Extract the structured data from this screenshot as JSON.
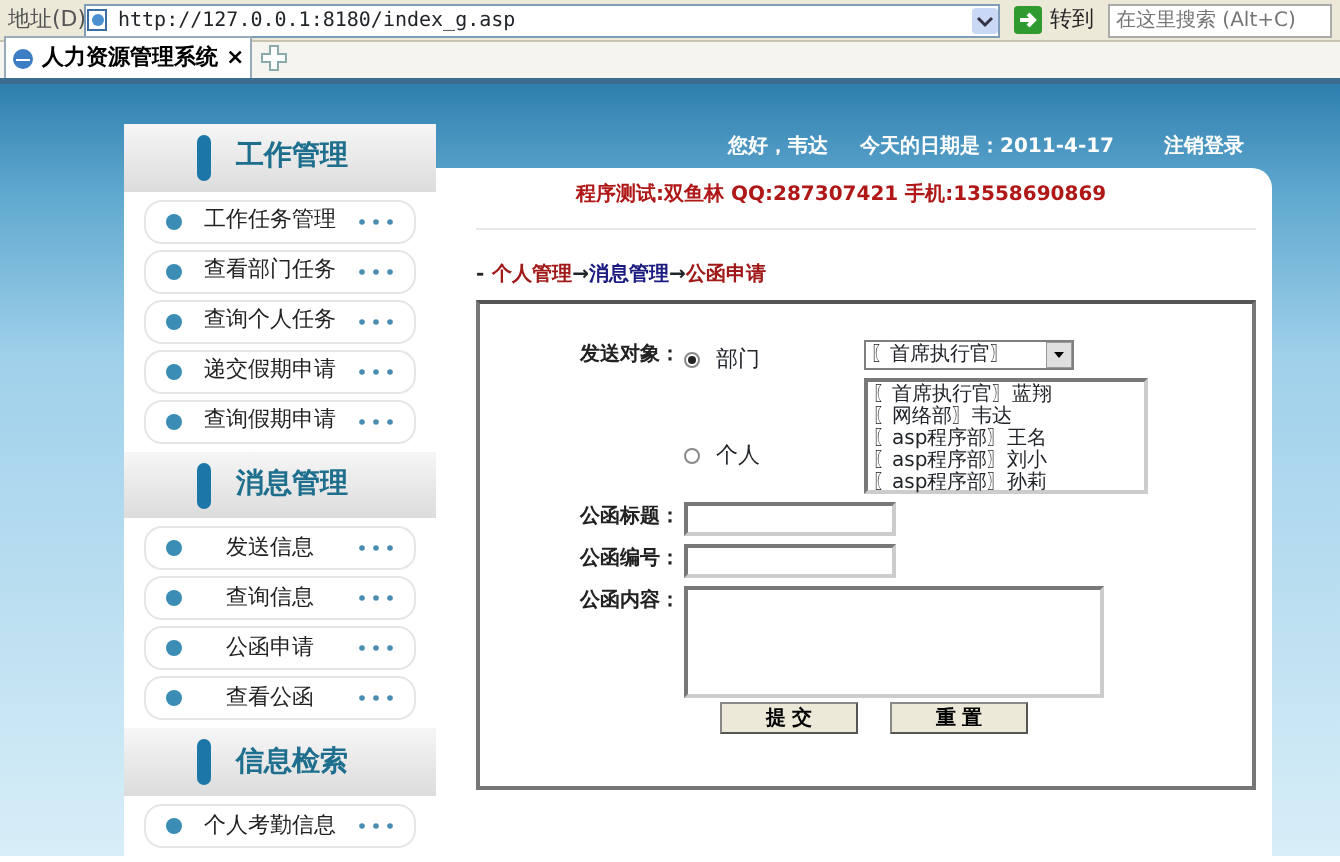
{
  "browser": {
    "address_label": "地址(D)",
    "url": "http://127.0.0.1:8180/index_g.asp",
    "go_button": "转到",
    "search_placeholder": "在这里搜索 (Alt+C)",
    "tabs": [
      {
        "label": "人力资源管理系统",
        "selected": true,
        "close": "×"
      }
    ]
  },
  "sidebar": {
    "sections": [
      {
        "title": "工作管理",
        "items": [
          {
            "label": "工作任务管理"
          },
          {
            "label": "查看部门任务"
          },
          {
            "label": "查询个人任务"
          },
          {
            "label": "递交假期申请"
          },
          {
            "label": "查询假期申请"
          }
        ]
      },
      {
        "title": "消息管理",
        "items": [
          {
            "label": "发送信息"
          },
          {
            "label": "查询信息"
          },
          {
            "label": "公函申请"
          },
          {
            "label": "查看公函"
          }
        ]
      },
      {
        "title": "信息检索",
        "items": [
          {
            "label": "个人考勤信息"
          }
        ]
      }
    ]
  },
  "header": {
    "greeting": "您好，韦达",
    "date_text": "今天的日期是：2011-4-17",
    "logout": "注销登录"
  },
  "notice": "程序测试:双鱼林 QQ:287307421 手机:13558690869",
  "breadcrumb": {
    "prefix": "-",
    "items": [
      {
        "label": "个人管理",
        "color": "#a01818"
      },
      {
        "label": "消息管理",
        "color": "#1a1a80"
      },
      {
        "label": "公函申请",
        "color": "#a01818"
      }
    ],
    "separator": "→"
  },
  "form": {
    "recipient_label": "发送对象：",
    "recipient_options": [
      {
        "label": "部门",
        "selected": true
      },
      {
        "label": "个人",
        "selected": false
      }
    ],
    "department_select": "〖首席执行官〗",
    "people_list": [
      "〖首席执行官〗蓝翔",
      "〖网络部〗韦达",
      "〖asp程序部〗王名",
      "〖asp程序部〗刘小",
      "〖asp程序部〗孙莉"
    ],
    "fields": [
      {
        "label": "公函标题：",
        "kind": "input"
      },
      {
        "label": "公函编号：",
        "kind": "input"
      },
      {
        "label": "公函内容：",
        "kind": "textarea"
      }
    ],
    "buttons": [
      "提 交",
      "重 置"
    ]
  }
}
